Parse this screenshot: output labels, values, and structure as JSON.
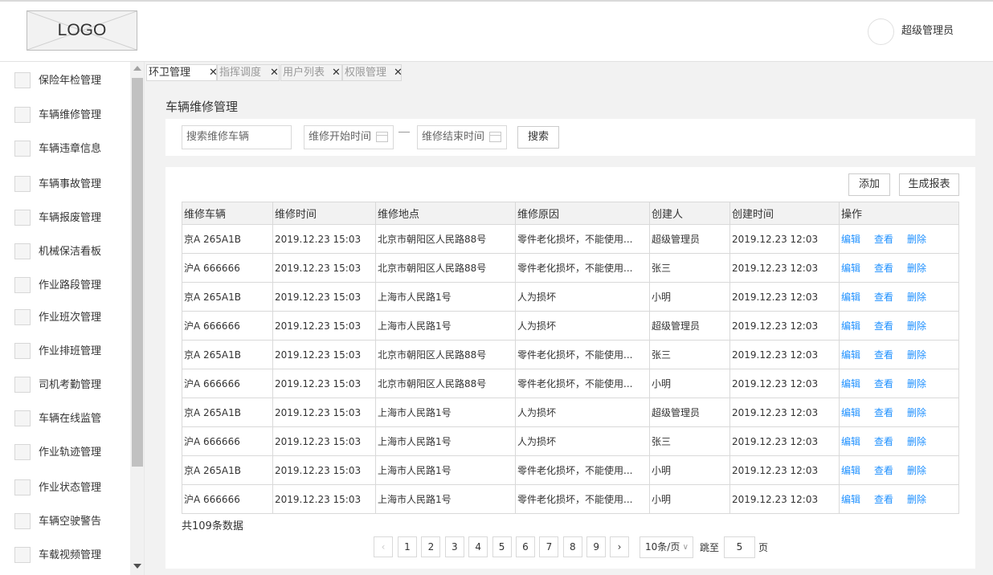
{
  "header": {
    "logo_text": "LOGO",
    "username": "超级管理员"
  },
  "sidebar": {
    "items": [
      "保险年检管理",
      "车辆维修管理",
      "车辆违章信息",
      "车辆事故管理",
      "车辆报废管理",
      "机械保洁看板",
      "作业路段管理",
      "作业班次管理",
      "作业排班管理",
      "司机考勤管理",
      "车辆在线监管",
      "作业轨迹管理",
      "作业状态管理",
      "车辆空驶警告",
      "车载视频管理"
    ]
  },
  "tabs": [
    {
      "label": "环卫管理",
      "active": true
    },
    {
      "label": "指挥调度",
      "active": false
    },
    {
      "label": "用户列表",
      "active": false
    },
    {
      "label": "权限管理",
      "active": false
    }
  ],
  "tab_close_glyph": "✕",
  "main": {
    "title": "车辆维修管理",
    "search": {
      "vehicle_placeholder": "搜索维修车辆",
      "start_placeholder": "维修开始时间",
      "end_placeholder": "维修结束时间",
      "search_label": "搜索"
    },
    "actions": {
      "add_label": "添加",
      "report_label": "生成报表"
    },
    "table": {
      "columns": [
        "维修车辆",
        "维修时间",
        "维修地点",
        "维修原因",
        "创建人",
        "创建时间",
        "操作"
      ],
      "op_labels": {
        "edit": "编辑",
        "view": "查看",
        "delete": "删除"
      },
      "rows": [
        [
          "京A 265A1B",
          "2019.12.23 15:03",
          "北京市朝阳区人民路88号",
          "零件老化损坏，不能使用...",
          "超级管理员",
          "2019.12.23 12:03"
        ],
        [
          "沪A 666666",
          "2019.12.23 15:03",
          "北京市朝阳区人民路88号",
          "零件老化损坏，不能使用...",
          "张三",
          "2019.12.23 12:03"
        ],
        [
          "京A 265A1B",
          "2019.12.23 15:03",
          "上海市人民路1号",
          "人为损坏",
          "小明",
          "2019.12.23 12:03"
        ],
        [
          "沪A 666666",
          "2019.12.23 15:03",
          "上海市人民路1号",
          "人为损坏",
          "超级管理员",
          "2019.12.23 12:03"
        ],
        [
          "京A 265A1B",
          "2019.12.23 15:03",
          "北京市朝阳区人民路88号",
          "零件老化损坏，不能使用...",
          "张三",
          "2019.12.23 12:03"
        ],
        [
          "沪A 666666",
          "2019.12.23 15:03",
          "北京市朝阳区人民路88号",
          "零件老化损坏，不能使用...",
          "小明",
          "2019.12.23 12:03"
        ],
        [
          "京A 265A1B",
          "2019.12.23 15:03",
          "上海市人民路1号",
          "人为损坏",
          "超级管理员",
          "2019.12.23 12:03"
        ],
        [
          "沪A 666666",
          "2019.12.23 15:03",
          "上海市人民路1号",
          "人为损坏",
          "张三",
          "2019.12.23 12:03"
        ],
        [
          "京A 265A1B",
          "2019.12.23 15:03",
          "上海市人民路1号",
          "零件老化损坏，不能使用...",
          "小明",
          "2019.12.23 12:03"
        ],
        [
          "沪A 666666",
          "2019.12.23 15:03",
          "上海市人民路1号",
          "零件老化损坏，不能使用...",
          "小明",
          "2019.12.23 12:03"
        ]
      ]
    },
    "pagination": {
      "total_text": "共109条数据",
      "prev_glyph": "‹",
      "next_glyph": "›",
      "pages": [
        "1",
        "2",
        "3",
        "4",
        "5",
        "6",
        "7",
        "8",
        "9"
      ],
      "page_size": "10条/页",
      "jump_label": "跳至",
      "jump_value": "5",
      "page_suffix": "页"
    }
  }
}
